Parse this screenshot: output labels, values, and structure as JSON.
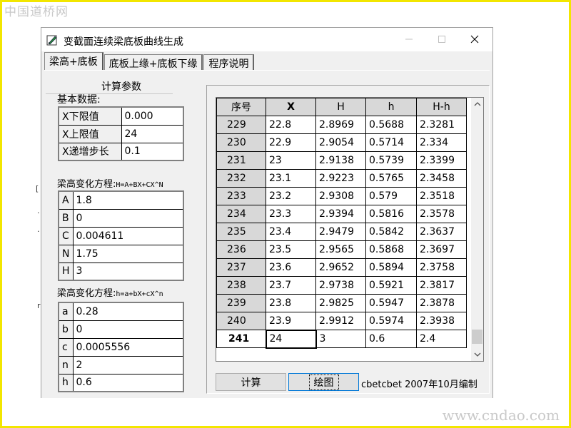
{
  "watermarks": {
    "top": "中国道桥网",
    "bottom": "www.cndao.com"
  },
  "window": {
    "title": "变截面连续梁底板曲线生成",
    "icon": "app-edit-icon"
  },
  "tabs": [
    {
      "label": "梁高+底板",
      "active": true
    },
    {
      "label": "底板上缘+底板下缘",
      "active": false
    },
    {
      "label": "程序说明",
      "active": false
    }
  ],
  "left": {
    "group_title": "计算参数",
    "basic_label": "基本数据:",
    "basic_rows": [
      {
        "key": "X下限值",
        "value": "0.000"
      },
      {
        "key": "X上限值",
        "value": "24"
      },
      {
        "key": "X递增步长",
        "value": "0.1"
      }
    ],
    "eq1_label_cn": "梁高变化方程:",
    "eq1_formula": "H=A+BX+CX^N",
    "eq1_rows": [
      {
        "key": "A",
        "value": "1.8"
      },
      {
        "key": "B",
        "value": "0"
      },
      {
        "key": "C",
        "value": "0.004611"
      },
      {
        "key": "N",
        "value": "1.75"
      },
      {
        "key": "H",
        "value": "3"
      }
    ],
    "eq2_label_cn": "梁高变化方程:",
    "eq2_formula": "h=a+bX+cX^n",
    "eq2_rows": [
      {
        "key": "a",
        "value": "0.28"
      },
      {
        "key": "b",
        "value": "0"
      },
      {
        "key": "c",
        "value": "0.0005556"
      },
      {
        "key": "n",
        "value": "2"
      },
      {
        "key": "h",
        "value": "0.6"
      }
    ]
  },
  "grid": {
    "headers": [
      "序号",
      "X",
      "H",
      "h",
      "H-h"
    ],
    "rows": [
      [
        "229",
        "22.8",
        "2.8969",
        "0.5688",
        "2.3281"
      ],
      [
        "230",
        "22.9",
        "2.9054",
        "0.5714",
        "2.334"
      ],
      [
        "231",
        "23",
        "2.9138",
        "0.5739",
        "2.3399"
      ],
      [
        "232",
        "23.1",
        "2.9223",
        "0.5765",
        "2.3458"
      ],
      [
        "233",
        "23.2",
        "2.9308",
        "0.579",
        "2.3518"
      ],
      [
        "234",
        "23.3",
        "2.9394",
        "0.5816",
        "2.3578"
      ],
      [
        "235",
        "23.4",
        "2.9479",
        "0.5842",
        "2.3637"
      ],
      [
        "236",
        "23.5",
        "2.9565",
        "0.5868",
        "2.3697"
      ],
      [
        "237",
        "23.6",
        "2.9652",
        "0.5894",
        "2.3758"
      ],
      [
        "238",
        "23.7",
        "2.9738",
        "0.5921",
        "2.3817"
      ],
      [
        "239",
        "23.8",
        "2.9825",
        "0.5947",
        "2.3878"
      ],
      [
        "240",
        "23.9",
        "2.9912",
        "0.5974",
        "2.3938"
      ],
      [
        "241",
        "24",
        "3",
        "0.6",
        "2.4"
      ]
    ]
  },
  "buttons": {
    "calc": "计算",
    "plot": "绘图"
  },
  "credit": "cbetcbet 2007年10月编制",
  "colors": {
    "frame": "#f2e600",
    "header_bg": "#d8d8d8",
    "window_bg": "#f0f0f0"
  }
}
